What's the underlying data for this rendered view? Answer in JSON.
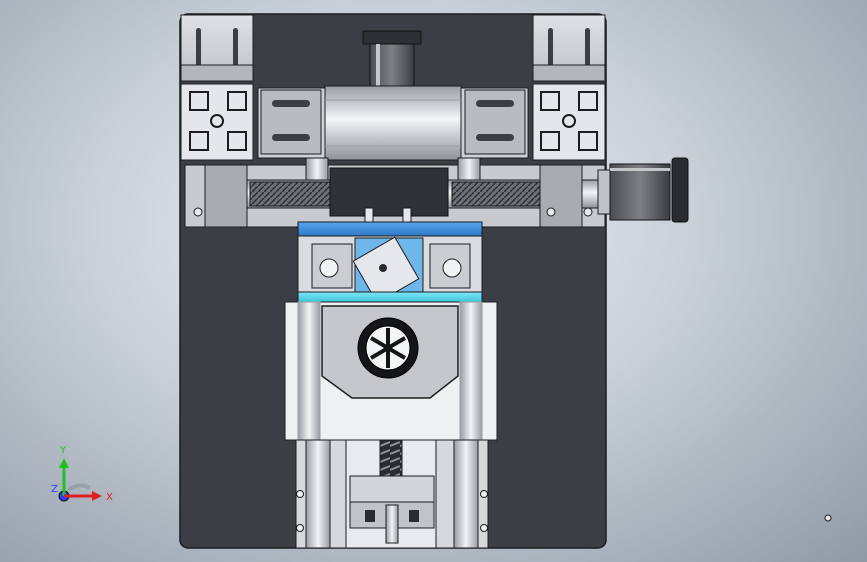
{
  "scene": {
    "description_name": "cad-assembly-view",
    "colors": {
      "background_center": "#eef1f4",
      "background_edge": "#8f9aa6",
      "housing": "#3b3f45",
      "metal_light": "#e8e9ec",
      "metal_mid": "#c9ccd1",
      "metal_dark": "#8d9096",
      "accent_blue": "#3f8fdc",
      "accent_cyan": "#4fd3e8",
      "outline": "#1b1d20"
    }
  },
  "triad": {
    "x_label": "X",
    "y_label": "Y",
    "z_label": "Z",
    "x_color": "#e02020",
    "y_color": "#21c021",
    "z_color": "#2a3cff"
  }
}
